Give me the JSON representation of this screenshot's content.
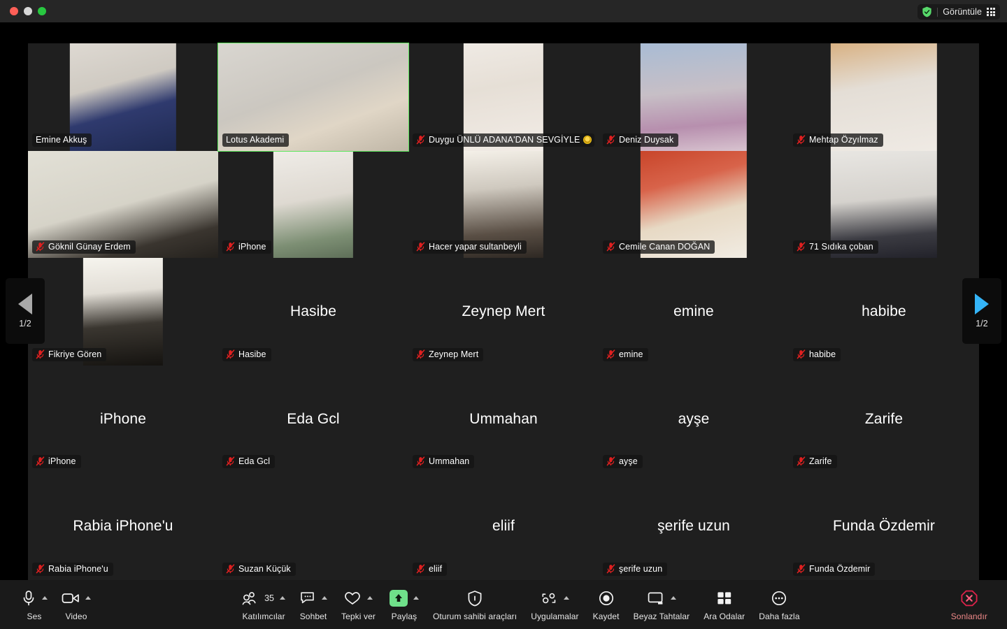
{
  "window": {
    "traffic_lights": [
      "close",
      "minimize",
      "zoom"
    ],
    "view_button": {
      "label": "Görüntüle",
      "shield_icon": "shield-check-icon",
      "grid_icon": "grid-view-icon",
      "shield_color": "#57d96a"
    }
  },
  "gallery": {
    "page_nav": {
      "prev": {
        "label": "1/2",
        "icon": "triangle-left-icon",
        "color": "#a9a9a9",
        "enabled": false
      },
      "next": {
        "label": "1/2",
        "icon": "triangle-right-icon",
        "color": "#34b4f7",
        "enabled": true
      }
    },
    "active_speaker_color": "#5ce65c",
    "tiles": [
      {
        "name": "Emine Akkuş",
        "muted": false,
        "video": true,
        "active": false,
        "fit": "portrait",
        "bg": "linear-gradient(165deg,#ded9d2 0%,#cfcac2 38%,#2f3a6e 62%,#1f2a52 100%)"
      },
      {
        "name": "Lotus Akademi",
        "muted": false,
        "video": true,
        "active": true,
        "fit": "full",
        "bg": "linear-gradient(160deg,#d9d6d0 0%,#cbc7c0 45%,#e0d6c6 70%,#bfb6a6 100%)"
      },
      {
        "name": "Duygu ÜNLÜ ADANA'DAN SEVGİYLE",
        "muted": true,
        "video": true,
        "active": false,
        "fit": "narrow",
        "bg": "linear-gradient(170deg,#efeae4 0%,#e6dfd6 40%,#f2ece6 100%)",
        "badge": "award-emoji"
      },
      {
        "name": "Deniz Duysak",
        "muted": true,
        "video": true,
        "active": false,
        "fit": "portrait",
        "bg": "linear-gradient(175deg,#a9bcd4 0%,#c7bfc6 45%,#b78fae 75%,#d8c3cf 100%)"
      },
      {
        "name": "Mehtap Özyılmaz",
        "muted": true,
        "video": true,
        "active": false,
        "fit": "portrait",
        "bg": "linear-gradient(170deg,#d8b183 0%,#e4ded6 40%,#efeae4 100%)"
      },
      {
        "name": "Göknil Günay Erdem",
        "muted": true,
        "video": true,
        "active": false,
        "fit": "full",
        "bg": "linear-gradient(165deg,#e2e0d6 0%,#d6d3c8 50%,#3a352f 80%,#24211d 100%)"
      },
      {
        "name": "iPhone",
        "muted": true,
        "video": true,
        "active": false,
        "fit": "narrow",
        "bg": "linear-gradient(170deg,#efece7 0%,#ded9d1 45%,#7d8f74 80%,#5e6f58 100%)"
      },
      {
        "name": "Hacer yapar sultanbeyli",
        "muted": true,
        "video": true,
        "active": false,
        "fit": "narrow",
        "bg": "linear-gradient(175deg,#f4f0e8 0%,#cfc9bf 35%,#5a4f45 75%,#2e2823 100%)"
      },
      {
        "name": "Cemile Canan DOĞAN",
        "muted": true,
        "video": true,
        "active": false,
        "fit": "portrait",
        "bg": "linear-gradient(165deg,#c8452a 0%,#d8634a 30%,#e7d9c4 60%,#f1ece3 100%)"
      },
      {
        "name": "71 Sıdıka çoban",
        "muted": true,
        "video": true,
        "active": false,
        "fit": "portrait",
        "bg": "linear-gradient(175deg,#e8e6e2 0%,#d5d2cd 45%,#3b3b42 78%,#22222a 100%)"
      },
      {
        "name": "Fikriye Gören",
        "muted": true,
        "video": true,
        "active": false,
        "fit": "narrow",
        "bg": "linear-gradient(175deg,#f6f4ee 0%,#e2ded6 32%,#3a3630 62%,#151310 100%)"
      },
      {
        "name": "Hasibe",
        "muted": true,
        "video": false,
        "active": false
      },
      {
        "name": "Zeynep Mert",
        "muted": true,
        "video": false,
        "active": false
      },
      {
        "name": "emine",
        "muted": true,
        "video": false,
        "active": false
      },
      {
        "name": "habibe",
        "muted": true,
        "video": false,
        "active": false
      },
      {
        "name": "iPhone",
        "muted": true,
        "video": false,
        "active": false
      },
      {
        "name": "Eda Gcl",
        "muted": true,
        "video": false,
        "active": false
      },
      {
        "name": "Ummahan",
        "muted": true,
        "video": false,
        "active": false
      },
      {
        "name": "ayşe",
        "muted": true,
        "video": false,
        "active": false
      },
      {
        "name": "Zarife",
        "muted": true,
        "video": false,
        "active": false
      },
      {
        "name": "Rabia iPhone'u",
        "muted": true,
        "video": false,
        "active": false
      },
      {
        "name": "Suzan Küçük",
        "muted": true,
        "video": true,
        "active": false,
        "fit": "rounded",
        "bg": "linear-gradient(165deg,#f2ece2 0%,#e6dccb 35%,#e4793a 72%,#c85f28 100%)"
      },
      {
        "name": "eliif",
        "muted": true,
        "video": false,
        "active": false
      },
      {
        "name": "şerife uzun",
        "muted": true,
        "video": false,
        "active": false
      },
      {
        "name": "Funda Özdemir",
        "muted": true,
        "video": false,
        "active": false
      }
    ]
  },
  "toolbar": {
    "audio": {
      "label": "Ses",
      "icon": "microphone-icon",
      "has_chevron": true
    },
    "video": {
      "label": "Video",
      "icon": "camera-icon",
      "has_chevron": true
    },
    "participants": {
      "label": "Katılımcılar",
      "icon": "participants-icon",
      "count": "35",
      "has_chevron": true
    },
    "chat": {
      "label": "Sohbet",
      "icon": "chat-bubble-icon",
      "has_chevron": true
    },
    "react": {
      "label": "Tepki ver",
      "icon": "heart-icon",
      "has_chevron": true
    },
    "share": {
      "label": "Paylaş",
      "icon": "share-screen-icon",
      "has_chevron": true,
      "accent": "#6fe08a"
    },
    "host_tools": {
      "label": "Oturum sahibi araçları",
      "icon": "shield-icon",
      "has_chevron": false
    },
    "apps": {
      "label": "Uygulamalar",
      "icon": "apps-icon",
      "has_chevron": true
    },
    "record": {
      "label": "Kaydet",
      "icon": "record-icon",
      "has_chevron": false
    },
    "whiteboard": {
      "label": "Beyaz Tahtalar",
      "icon": "whiteboard-icon",
      "has_chevron": true
    },
    "breakout": {
      "label": "Ara Odalar",
      "icon": "breakout-rooms-icon",
      "has_chevron": false
    },
    "more": {
      "label": "Daha fazla",
      "icon": "more-dots-icon",
      "has_chevron": false
    },
    "end": {
      "label": "Sonlandır",
      "icon": "end-call-icon",
      "has_chevron": false,
      "accent": "#e0214a"
    }
  }
}
